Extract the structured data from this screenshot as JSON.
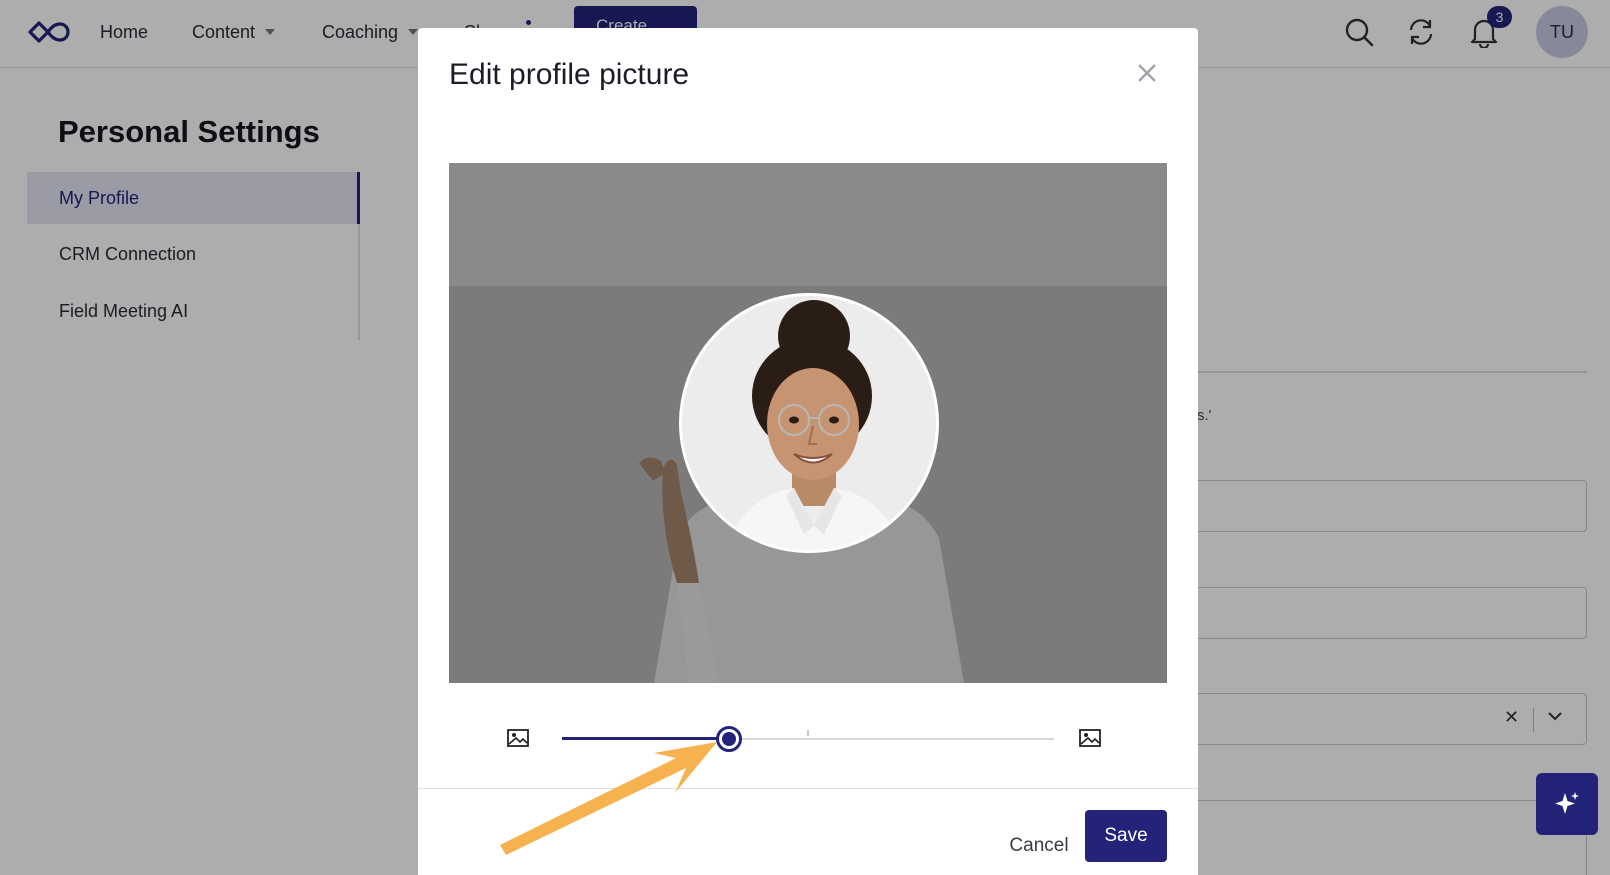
{
  "nav": {
    "logo_icon": "infinity-logo",
    "items": [
      {
        "label": "Home"
      },
      {
        "label": "Content"
      },
      {
        "label": "Coaching"
      },
      {
        "label": "Sh"
      }
    ],
    "create_label": "Create",
    "notifications_count": "3",
    "avatar_initials": "TU"
  },
  "settings": {
    "title": "Personal Settings",
    "items": [
      {
        "label": "My Profile",
        "active": true
      },
      {
        "label": "CRM Connection"
      },
      {
        "label": "Field Meeting AI"
      }
    ]
  },
  "background_form": {
    "snippet_text": "s.'"
  },
  "modal": {
    "title": "Edit profile picture",
    "close_icon": "close-icon",
    "zoom": {
      "min_icon": "image-small-icon",
      "max_icon": "image-large-icon",
      "value_fraction": 0.34
    },
    "cancel_label": "Cancel",
    "save_label": "Save"
  },
  "colors": {
    "accent": "#23237a",
    "annotation_arrow": "#f6b24e"
  }
}
